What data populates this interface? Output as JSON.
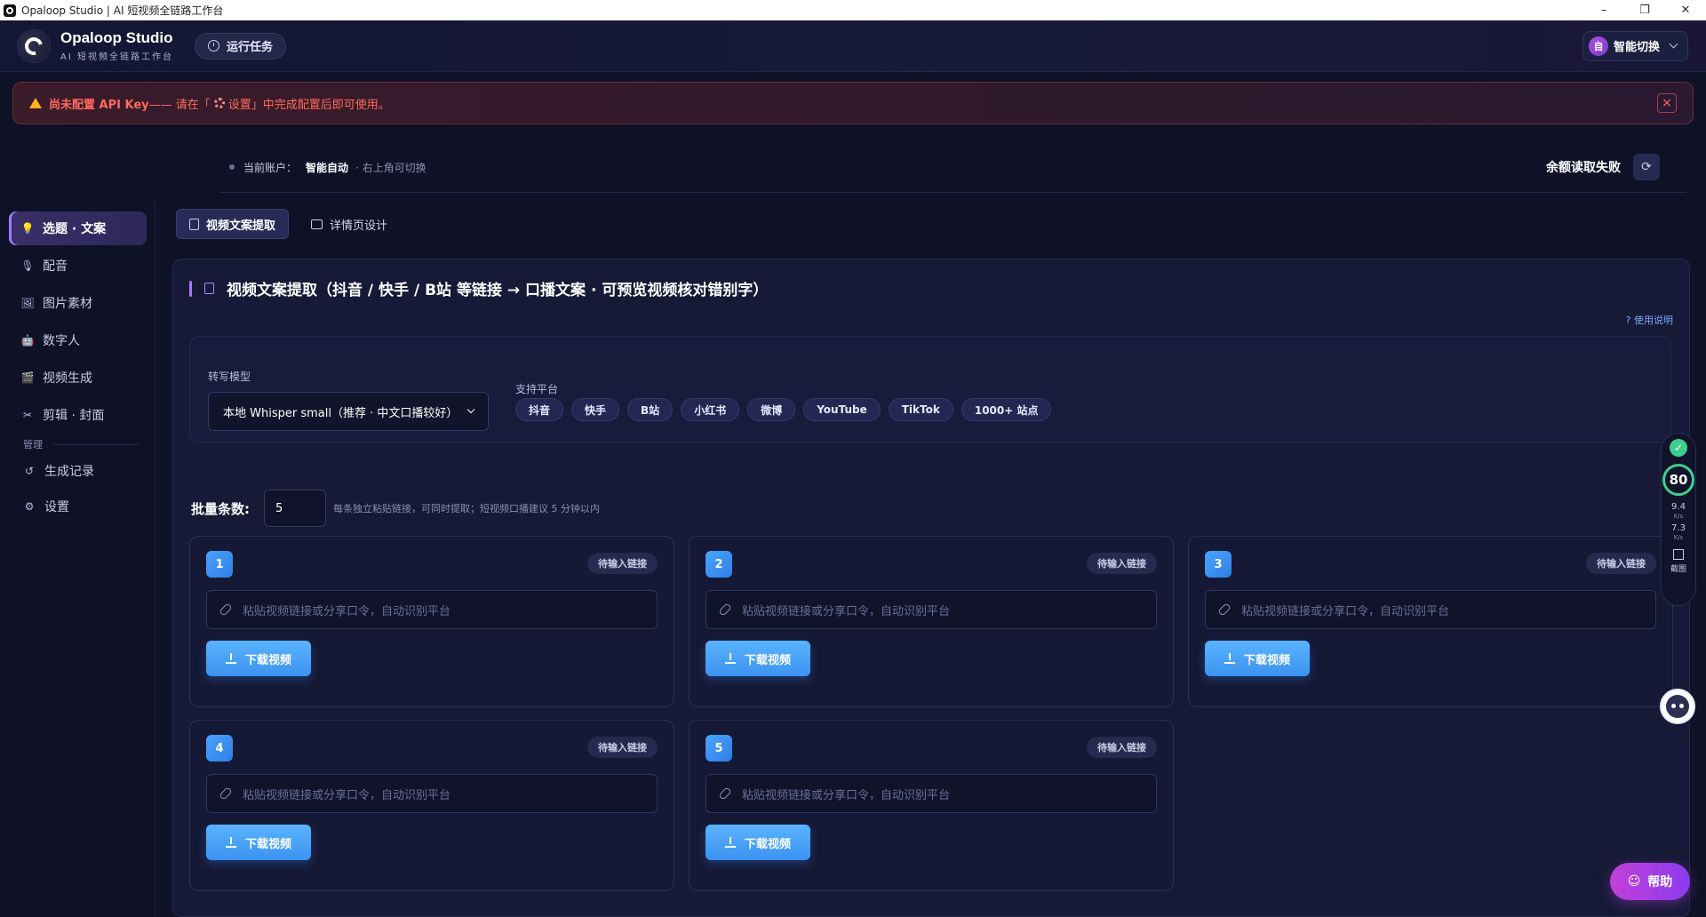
{
  "window": {
    "title": "Opaloop Studio | AI 短视频全链路工作台",
    "controls": [
      "–",
      "❐",
      "✕"
    ]
  },
  "header": {
    "brand_name": "Opaloop Studio",
    "brand_sub": "AI 短视频全链路工作台",
    "run_task_label": "运行任务",
    "switch_avatar": "自",
    "switch_label": "智能切换"
  },
  "banner": {
    "strong": "尚未配置 API Key",
    "text_before": " —— 请在「",
    "settings_word": "设置",
    "text_after": "」中完成配置后即可使用。",
    "close": "×"
  },
  "account": {
    "label": "当前账户：",
    "name": "智能自动",
    "hint": "· 右上角可切换",
    "balance": "余额读取失败",
    "refresh": "⟳"
  },
  "sidebar": {
    "items": [
      {
        "label": "选题 · 文案",
        "icon": "💡"
      },
      {
        "label": "配音",
        "icon": "🎙"
      },
      {
        "label": "图片素材",
        "icon": "🖼"
      },
      {
        "label": "数字人",
        "icon": "🤖"
      },
      {
        "label": "视频生成",
        "icon": "🎬"
      },
      {
        "label": "剪辑 · 封面",
        "icon": "✂"
      }
    ],
    "section_label": "管理",
    "manage_items": [
      {
        "label": "生成记录",
        "icon": "↺"
      },
      {
        "label": "设置",
        "icon": "⚙"
      }
    ]
  },
  "tabs": [
    {
      "label": "视频文案提取"
    },
    {
      "label": "详情页设计"
    }
  ],
  "panel": {
    "title": "视频文案提取（抖音 / 快手 / B站 等链接 → 口播文案 · 可预览视频核对错别字）",
    "help_link": "? 使用说明",
    "model_label": "转写模型",
    "model_value": "本地 Whisper small（推荐 · 中文口播较好）",
    "platform_label": "支持平台",
    "platforms": [
      "抖音",
      "快手",
      "B站",
      "小红书",
      "微博",
      "YouTube",
      "TikTok",
      "1000+ 站点"
    ],
    "batch_label": "批量条数:",
    "batch_value": "5",
    "batch_hint": "每条独立粘贴链接，可同时提取；短视频口播建议 5 分钟以内"
  },
  "cards": [
    {
      "num": "1",
      "status": "待输入链接",
      "placeholder": "粘贴视频链接或分享口令，自动识别平台",
      "button": "下载视频"
    },
    {
      "num": "2",
      "status": "待输入链接",
      "placeholder": "粘贴视频链接或分享口令，自动识别平台",
      "button": "下载视频"
    },
    {
      "num": "3",
      "status": "待输入链接",
      "placeholder": "粘贴视频链接或分享口令，自动识别平台",
      "button": "下载视频"
    },
    {
      "num": "4",
      "status": "待输入链接",
      "placeholder": "粘贴视频链接或分享口令，自动识别平台",
      "button": "下载视频"
    },
    {
      "num": "5",
      "status": "待输入链接",
      "placeholder": "粘贴视频链接或分享口令，自动识别平台",
      "button": "下载视频"
    }
  ],
  "widget": {
    "ok": "✓",
    "score": "80",
    "up_speed": "9.4",
    "up_unit": "K/s",
    "down_speed": "7.3",
    "down_unit": "K/s",
    "screenshot": "截图"
  },
  "help_button": "帮助",
  "colors": {
    "accent": "#9c7cff",
    "primary_button": "#3b93f0",
    "warning": "#ff6a5a",
    "success": "#3ecf8e",
    "help": "#c240d8"
  }
}
